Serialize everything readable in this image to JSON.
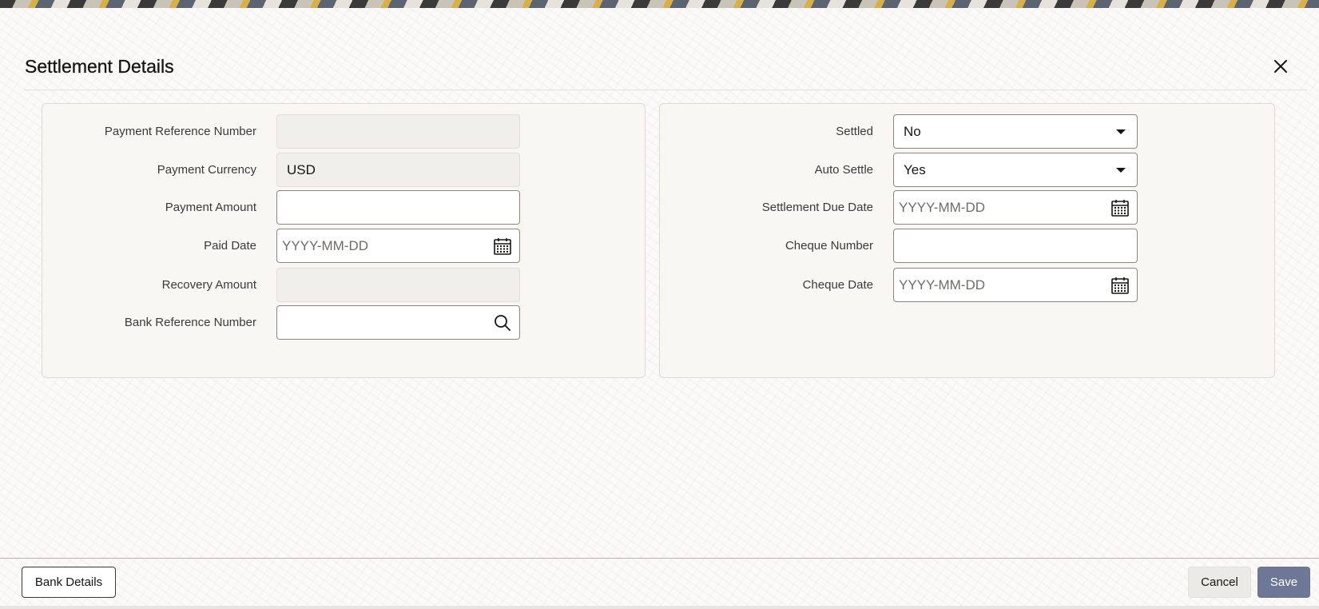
{
  "modal": {
    "title": "Settlement Details",
    "close_icon": "close-icon"
  },
  "left_panel": {
    "payment_reference_number": {
      "label": "Payment Reference Number",
      "value": ""
    },
    "payment_currency": {
      "label": "Payment Currency",
      "value": "USD"
    },
    "payment_amount": {
      "label": "Payment Amount",
      "value": ""
    },
    "paid_date": {
      "label": "Paid Date",
      "placeholder": "YYYY-MM-DD",
      "icon": "calendar-icon"
    },
    "recovery_amount": {
      "label": "Recovery Amount",
      "value": ""
    },
    "bank_reference_number": {
      "label": "Bank Reference Number",
      "value": "",
      "icon": "search-icon"
    }
  },
  "right_panel": {
    "settled": {
      "label": "Settled",
      "selected": "No"
    },
    "auto_settle": {
      "label": "Auto Settle",
      "selected": "Yes"
    },
    "settlement_due_date": {
      "label": "Settlement Due Date",
      "placeholder": "YYYY-MM-DD",
      "icon": "calendar-icon"
    },
    "cheque_number": {
      "label": "Cheque Number",
      "value": ""
    },
    "cheque_date": {
      "label": "Cheque Date",
      "placeholder": "YYYY-MM-DD",
      "icon": "calendar-icon"
    }
  },
  "footer": {
    "bank_details_label": "Bank Details",
    "cancel_label": "Cancel",
    "save_label": "Save"
  },
  "colors": {
    "primary_button": "#6e7896",
    "text": "#161513",
    "border": "#8b8780"
  }
}
